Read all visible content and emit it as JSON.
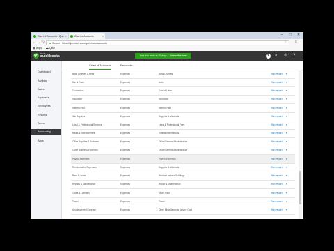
{
  "browser": {
    "tabs": [
      {
        "label": "Chart of Accounts - Quic"
      },
      {
        "label": "Chart of Accounts"
      }
    ],
    "url": "https://qbo.intuit.com/app/chartofaccounts",
    "url_prefix": "Secure",
    "bookmarks": {
      "apps": "Apps",
      "folder": "QBO"
    },
    "window_controls": {
      "minimize": "–",
      "maximize": "□",
      "close": "✕"
    }
  },
  "app": {
    "logo_letter": "qb",
    "brand_small": "intuit",
    "brand_name": "quickbooks",
    "trial_text": "Your trial ends in 30 days",
    "subscribe_label": "Subscribe now"
  },
  "sidebar": {
    "items": [
      {
        "label": "Dashboard"
      },
      {
        "label": "Banking"
      },
      {
        "label": "Sales"
      },
      {
        "label": "Expenses"
      },
      {
        "label": "Employees"
      },
      {
        "label": "Reports"
      },
      {
        "label": "Taxes"
      },
      {
        "label": "Accounting"
      },
      {
        "label": "Apps"
      }
    ]
  },
  "content_tabs": {
    "chart_of_accounts": "Chart of Accounts",
    "reconcile": "Reconcile"
  },
  "rows": [
    {
      "name": "Bank Charges & Fees",
      "type": "Expenses",
      "detail": "Bank Charges",
      "action": "Run report"
    },
    {
      "name": "Car & Truck",
      "type": "Expenses",
      "detail": "Auto",
      "action": "Run report"
    },
    {
      "name": "Contractors",
      "type": "Expenses",
      "detail": "Cost of Labor",
      "action": "Run report"
    },
    {
      "name": "Insurance",
      "type": "Expenses",
      "detail": "Insurance",
      "action": "Run report"
    },
    {
      "name": "Interest Paid",
      "type": "Expenses",
      "detail": "Interest Paid",
      "action": "Run report"
    },
    {
      "name": "Job Supplies",
      "type": "Expenses",
      "detail": "Supplies & Materials",
      "action": "Run report"
    },
    {
      "name": "Legal & Professional Services",
      "type": "Expenses",
      "detail": "Legal & Professional Fees",
      "action": "Run report"
    },
    {
      "name": "Meals & Entertainment",
      "type": "Expenses",
      "detail": "Entertainment Meals",
      "action": "Run report"
    },
    {
      "name": "Office Supplies & Software",
      "type": "Expenses",
      "detail": "Office/General Administrative",
      "action": "Run report"
    },
    {
      "name": "Other Business Expenses",
      "type": "Expenses",
      "detail": "Office/General Administrative",
      "action": "Run report"
    },
    {
      "name": "Payroll Expenses",
      "type": "Expenses",
      "detail": "Payroll Expenses",
      "action": "Run report"
    },
    {
      "name": "Reimbursable Expenses",
      "type": "Expenses",
      "detail": "Supplies & Materials",
      "action": "Run report"
    },
    {
      "name": "Rent & Lease",
      "type": "Expenses",
      "detail": "Rent or Lease of Buildings",
      "action": "Run report"
    },
    {
      "name": "Repairs & Maintenance",
      "type": "Expenses",
      "detail": "Repair & Maintenance",
      "action": "Run report"
    },
    {
      "name": "Taxes & Licenses",
      "type": "Expenses",
      "detail": "Taxes Paid",
      "action": "Run report"
    },
    {
      "name": "Travel",
      "type": "Expenses",
      "detail": "Travel",
      "action": "Run report"
    },
    {
      "name": "Uncategorized Expense",
      "type": "Expenses",
      "detail": "Other Miscellaneous Service Cost",
      "action": "Run report"
    }
  ],
  "colors": {
    "accent": "#2ca01c",
    "link": "#0077c5",
    "header": "#353535"
  }
}
